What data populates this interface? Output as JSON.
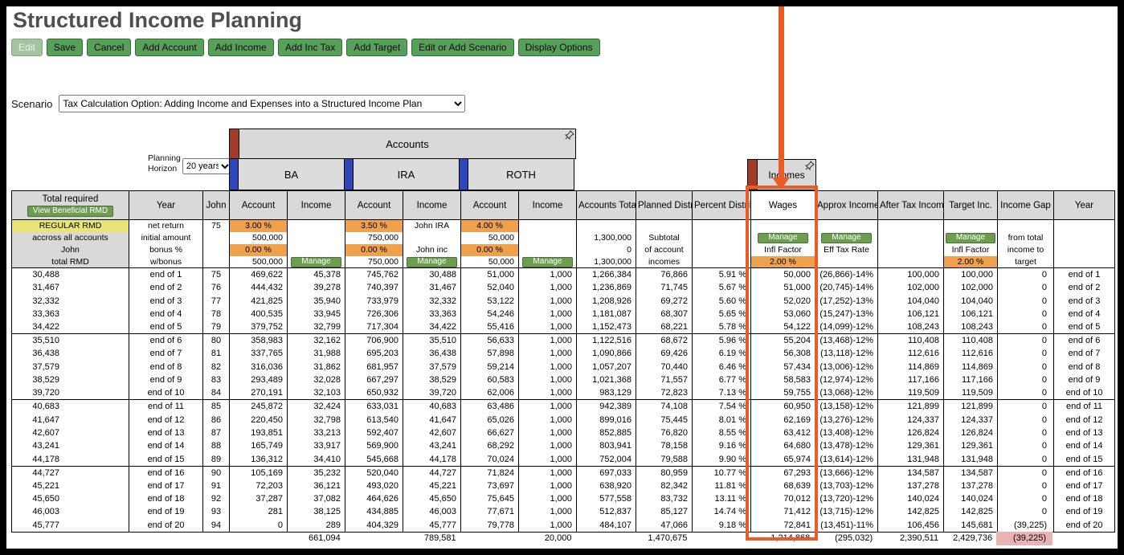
{
  "page": {
    "title": "Structured Income Planning"
  },
  "toolbar": {
    "buttons": [
      "Edit",
      "Save",
      "Cancel",
      "Add Account",
      "Add Income",
      "Add Inc Tax",
      "Add Target",
      "Edit or Add Scenario",
      "Display Options"
    ]
  },
  "scenario": {
    "label": "Scenario",
    "value": "Tax Calculation Option: Adding Income and Expenses into a Structured Income Plan"
  },
  "planning_horizon": {
    "label_line1": "Planning",
    "label_line2": "Horizon",
    "value": "20 years"
  },
  "accounts_panel": {
    "title": "Accounts",
    "groups": [
      "BA",
      "IRA",
      "ROTH"
    ]
  },
  "incomes_panel": {
    "title": "Incomes"
  },
  "icons": {
    "pin": "pushpin"
  },
  "colors": {
    "button_green": "#57a05a",
    "manage_green": "#6d9d4f",
    "header_grey": "#d9d9d9",
    "rate_orange": "#f0a14e",
    "rmd_yellow": "#e9e476",
    "negative_pink": "#e9b3b3",
    "group_bar_blue": "#2d47b8",
    "panel_bar_red": "#a23b28",
    "annotation_orange": "#ee5a24"
  },
  "table": {
    "headers": [
      "Total required",
      "Year",
      "John",
      "Account",
      "Income",
      "Account",
      "Income",
      "Account",
      "Income",
      "Accounts Total",
      "Planned Distribution",
      "Percent Distribution",
      "Wages",
      "Approx Income Tax",
      "After Tax Income",
      "Target Inc.",
      "Income Gap",
      "Year"
    ],
    "meta": {
      "view_beneficial_rmd": "View Beneficial RMD",
      "regular_rmd": "REGULAR RMD",
      "across_accounts": "accross all accounts",
      "john": "John",
      "total_rmd": "total RMD",
      "net_return": "net return",
      "initial_amount": "initial amount",
      "bonus_pct": "bonus %",
      "w_bonus": "w/bonus",
      "age": "75",
      "ba_return": "3.00 %",
      "ira_return": "3.50 %",
      "roth_return": "4.00 %",
      "ira_account_name": "John IRA",
      "ira_income_name": "John inc",
      "ba_initial": "500,000",
      "ira_initial": "750,000",
      "roth_initial": "50,000",
      "total_initial": "1,300,000",
      "ba_bonus": "0.00 %",
      "ira_bonus": "0.00 %",
      "roth_bonus": "0.00 %",
      "total_bonus": "0",
      "ba_wbonus": "500,000",
      "ira_wbonus": "750,000",
      "roth_wbonus": "50,000",
      "total_wbonus": "1,300,000",
      "planned_sub1": "Subtotal",
      "planned_sub2": "of account",
      "planned_sub3": "incomes",
      "manage": "Manage",
      "infl_factor": "Infl Factor",
      "eff_tax_rate": "Eff Tax Rate",
      "wages_infl": "2.00 %",
      "target_infl": "2.00 %",
      "gap_sub1": "from total",
      "gap_sub2": "income to",
      "gap_sub3": "target"
    },
    "rows": [
      [
        "30,488",
        "end of 1",
        "75",
        "469,622",
        "45,378",
        "745,762",
        "30,488",
        "51,000",
        "1,000",
        "1,266,384",
        "76,866",
        "5.91 %",
        "50,000",
        "(26,866)-14%",
        "100,000",
        "100,000",
        "0",
        "end of 1"
      ],
      [
        "31,467",
        "end of 2",
        "76",
        "444,432",
        "39,278",
        "740,397",
        "31,467",
        "52,040",
        "1,000",
        "1,236,869",
        "71,745",
        "5.67 %",
        "51,000",
        "(20,745)-14%",
        "102,000",
        "102,000",
        "0",
        "end of 2"
      ],
      [
        "32,332",
        "end of 3",
        "77",
        "421,825",
        "35,940",
        "733,979",
        "32,332",
        "53,122",
        "1,000",
        "1,208,926",
        "69,272",
        "5.60 %",
        "52,020",
        "(17,252)-13%",
        "104,040",
        "104,040",
        "0",
        "end of 3"
      ],
      [
        "33,363",
        "end of 4",
        "78",
        "400,535",
        "33,945",
        "726,306",
        "33,363",
        "54,246",
        "1,000",
        "1,181,087",
        "68,307",
        "5.65 %",
        "53,060",
        "(15,247)-13%",
        "106,121",
        "106,121",
        "0",
        "end of 4"
      ],
      [
        "34,422",
        "end of 5",
        "79",
        "379,752",
        "32,799",
        "717,304",
        "34,422",
        "55,416",
        "1,000",
        "1,152,473",
        "68,221",
        "5.78 %",
        "54,122",
        "(14,099)-12%",
        "108,243",
        "108,243",
        "0",
        "end of 5"
      ],
      [
        "35,510",
        "end of 6",
        "80",
        "358,983",
        "32,162",
        "706,900",
        "35,510",
        "56,633",
        "1,000",
        "1,122,516",
        "68,672",
        "5.96 %",
        "55,204",
        "(13,468)-12%",
        "110,408",
        "110,408",
        "0",
        "end of 6"
      ],
      [
        "36,438",
        "end of 7",
        "81",
        "337,765",
        "31,988",
        "695,203",
        "36,438",
        "57,898",
        "1,000",
        "1,090,866",
        "69,426",
        "6.19 %",
        "56,308",
        "(13,118)-12%",
        "112,616",
        "112,616",
        "0",
        "end of 7"
      ],
      [
        "37,579",
        "end of 8",
        "82",
        "316,036",
        "31,862",
        "681,957",
        "37,579",
        "59,214",
        "1,000",
        "1,057,207",
        "70,440",
        "6.46 %",
        "57,434",
        "(13,006)-12%",
        "114,869",
        "114,869",
        "0",
        "end of 8"
      ],
      [
        "38,529",
        "end of 9",
        "83",
        "293,489",
        "32,028",
        "667,297",
        "38,529",
        "60,583",
        "1,000",
        "1,021,368",
        "71,557",
        "6.77 %",
        "58,583",
        "(12,974)-12%",
        "117,166",
        "117,166",
        "0",
        "end of 9"
      ],
      [
        "39,720",
        "end of 10",
        "84",
        "270,191",
        "32,103",
        "650,932",
        "39,720",
        "62,006",
        "1,000",
        "983,129",
        "72,823",
        "7.13 %",
        "59,755",
        "(13,068)-12%",
        "119,509",
        "119,509",
        "0",
        "end of 10"
      ],
      [
        "40,683",
        "end of 11",
        "85",
        "245,872",
        "32,424",
        "633,031",
        "40,683",
        "63,486",
        "1,000",
        "942,389",
        "74,108",
        "7.54 %",
        "60,950",
        "(13,158)-12%",
        "121,899",
        "121,899",
        "0",
        "end of 11"
      ],
      [
        "41,647",
        "end of 12",
        "86",
        "220,450",
        "32,798",
        "613,540",
        "41,647",
        "65,026",
        "1,000",
        "899,016",
        "75,445",
        "8.01 %",
        "62,169",
        "(13,276)-12%",
        "124,337",
        "124,337",
        "0",
        "end of 12"
      ],
      [
        "42,607",
        "end of 13",
        "87",
        "193,851",
        "33,213",
        "592,407",
        "42,607",
        "66,627",
        "1,000",
        "852,885",
        "76,820",
        "8.55 %",
        "63,412",
        "(13,408)-12%",
        "126,824",
        "126,824",
        "0",
        "end of 13"
      ],
      [
        "43,241",
        "end of 14",
        "88",
        "165,749",
        "33,917",
        "569,900",
        "43,241",
        "68,292",
        "1,000",
        "803,941",
        "78,158",
        "9.16 %",
        "64,680",
        "(13,478)-12%",
        "129,361",
        "129,361",
        "0",
        "end of 14"
      ],
      [
        "44,178",
        "end of 15",
        "89",
        "136,312",
        "34,410",
        "545,668",
        "44,178",
        "70,024",
        "1,000",
        "752,004",
        "79,588",
        "9.90 %",
        "65,974",
        "(13,614)-12%",
        "131,948",
        "131,948",
        "0",
        "end of 15"
      ],
      [
        "44,727",
        "end of 16",
        "90",
        "105,169",
        "35,232",
        "520,040",
        "44,727",
        "71,824",
        "1,000",
        "697,033",
        "80,959",
        "10.77 %",
        "67,293",
        "(13,666)-12%",
        "134,587",
        "134,587",
        "0",
        "end of 16"
      ],
      [
        "45,221",
        "end of 17",
        "91",
        "72,203",
        "36,121",
        "493,020",
        "45,221",
        "73,697",
        "1,000",
        "638,920",
        "82,342",
        "11.81 %",
        "68,639",
        "(13,703)-12%",
        "137,278",
        "137,278",
        "0",
        "end of 17"
      ],
      [
        "45,650",
        "end of 18",
        "92",
        "37,287",
        "37,082",
        "464,626",
        "45,650",
        "75,645",
        "1,000",
        "577,558",
        "83,732",
        "13.11 %",
        "70,012",
        "(13,720)-12%",
        "140,024",
        "140,024",
        "0",
        "end of 18"
      ],
      [
        "46,003",
        "end of 19",
        "93",
        "281",
        "38,125",
        "434,885",
        "46,003",
        "77,671",
        "1,000",
        "512,837",
        "85,127",
        "14.74 %",
        "71,412",
        "(13,715)-12%",
        "142,825",
        "142,825",
        "0",
        "end of 19"
      ],
      [
        "45,777",
        "end of 20",
        "94",
        "0",
        "289",
        "404,329",
        "45,777",
        "79,778",
        "1,000",
        "484,107",
        "47,066",
        "9.18 %",
        "72,841",
        "(13,451)-11%",
        "106,456",
        "145,681",
        "(39,225)",
        "end of 20"
      ]
    ],
    "totals": [
      "",
      "",
      "",
      "",
      "661,094",
      "",
      "789,581",
      "",
      "20,000",
      "",
      "1,470,675",
      "",
      "1,214,868",
      "(295,032)",
      "2,390,511",
      "2,429,736",
      "(39,225)",
      ""
    ]
  }
}
